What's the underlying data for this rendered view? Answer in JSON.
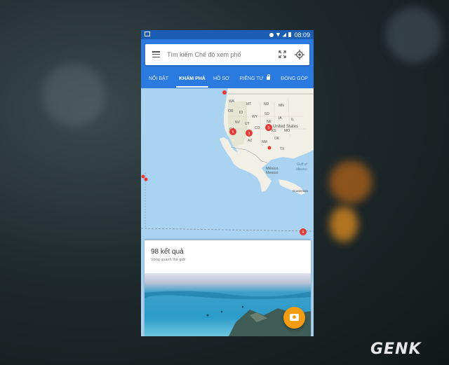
{
  "status_bar": {
    "time": "08:09"
  },
  "search": {
    "placeholder": "Tìm kiếm Chế độ xem phố"
  },
  "tabs": [
    {
      "label": "NỔI BẬT"
    },
    {
      "label": "KHÁM PHÁ"
    },
    {
      "label": "HỒ SƠ"
    },
    {
      "label": "RIÊNG TƯ"
    },
    {
      "label": "ĐÓNG GÓP"
    }
  ],
  "map": {
    "labels": {
      "wa": "WA",
      "mt": "MT",
      "nd": "ND",
      "mn": "MN",
      "or": "OR",
      "id": "ID",
      "wy": "WY",
      "sd": "SD",
      "ia": "IA",
      "il": "IL",
      "ne": "NE",
      "nv": "NV",
      "ut": "UT",
      "united_states": "United States",
      "ca": "CA",
      "co": "CO",
      "ks": "KS",
      "mo": "MO",
      "az": "AZ",
      "ok": "OK",
      "nm": "NM",
      "tx": "TX",
      "gulf": "Gulf of",
      "mexico_sea": "Mexico",
      "mexico_en": "México",
      "mexico_vi": "Mexico",
      "guatemala": "Guatemala"
    },
    "markers": [
      "5",
      "3",
      "5",
      "9"
    ]
  },
  "results": {
    "count": "98 kết quả",
    "subtitle": "Vòng quanh thế giới"
  },
  "watermark": "GENK"
}
